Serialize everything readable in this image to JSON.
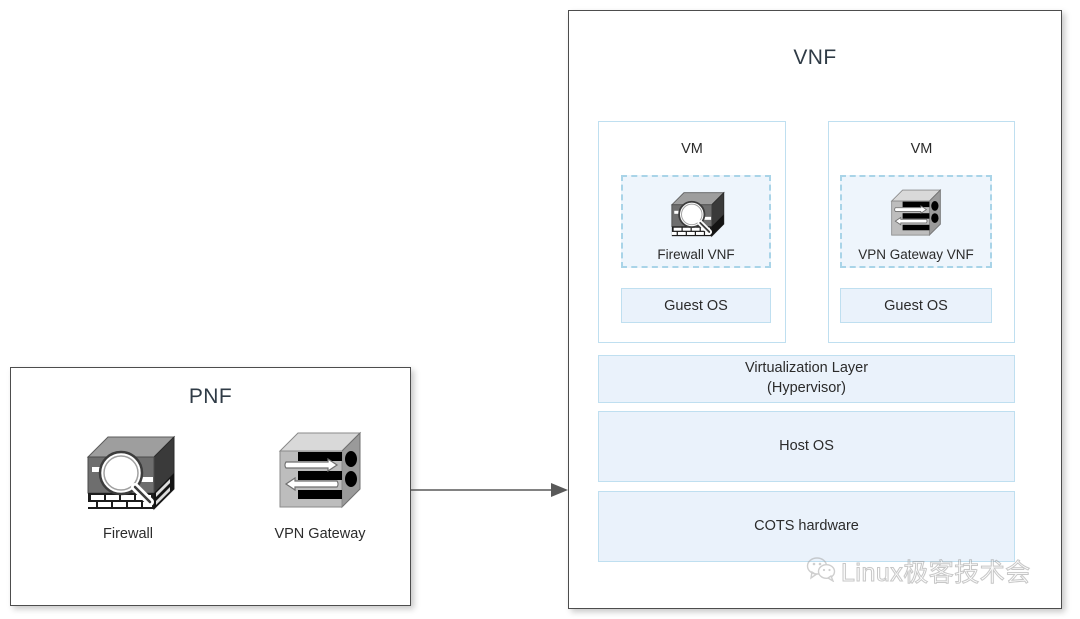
{
  "pnf": {
    "title": "PNF",
    "devices": [
      {
        "icon": "firewall-icon",
        "caption": "Firewall"
      },
      {
        "icon": "vpn-gateway-icon",
        "caption": "VPN Gateway"
      }
    ]
  },
  "vnf": {
    "title": "VNF",
    "vms": [
      {
        "label": "VM",
        "vnf_icon": "firewall-icon",
        "vnf_caption": "Firewall VNF",
        "guest_os": "Guest OS"
      },
      {
        "label": "VM",
        "vnf_icon": "vpn-gateway-icon",
        "vnf_caption": "VPN Gateway VNF",
        "guest_os": "Guest OS"
      }
    ],
    "layers": [
      {
        "line1": "Virtualization Layer",
        "line2": "(Hypervisor)"
      },
      {
        "line1": "Host OS",
        "line2": ""
      },
      {
        "line1": "COTS hardware",
        "line2": ""
      }
    ]
  },
  "connector": {
    "name": "arrow-right",
    "direction": "right"
  },
  "watermark": {
    "text": "Linux极客技术会",
    "icon": "wechat-icon"
  },
  "colors": {
    "panel_border": "#4d4d4d",
    "light_blue_border": "#bfdff0",
    "light_blue_fill": "#eaf2fb",
    "dashed_border": "#a9d4e8",
    "dashed_fill": "#eef5fc",
    "text": "#2b2b2b",
    "arrow": "#595959"
  }
}
